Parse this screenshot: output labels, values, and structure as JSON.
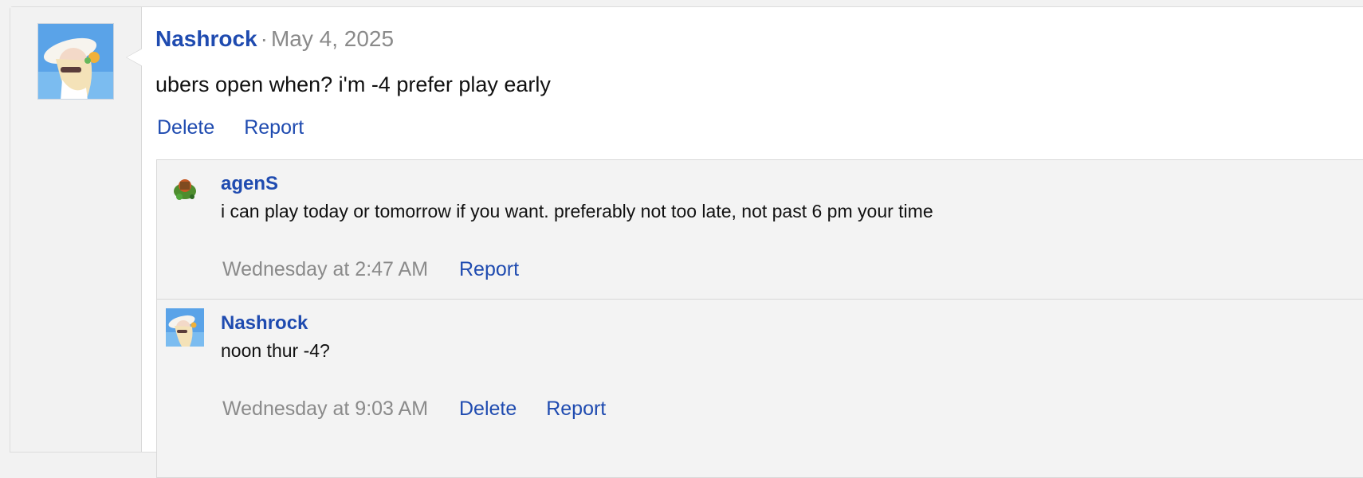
{
  "post": {
    "author": "Nashrock",
    "separator": "·",
    "date": "May 4, 2025",
    "message": "ubers open when? i'm -4 prefer play early",
    "delete_label": "Delete",
    "report_label": "Report"
  },
  "comments": [
    {
      "author": "agenS",
      "text": "i can play today or tomorrow if you want. preferably not too late, not past 6 pm your time",
      "time": "Wednesday at 2:47 AM",
      "report_label": "Report"
    },
    {
      "author": "Nashrock",
      "text": "noon thur -4?",
      "time": "Wednesday at 9:03 AM",
      "delete_label": "Delete",
      "report_label": "Report"
    }
  ],
  "colors": {
    "link": "#1f4bb0",
    "muted": "#8a8a8a",
    "panel": "#f3f3f3"
  }
}
